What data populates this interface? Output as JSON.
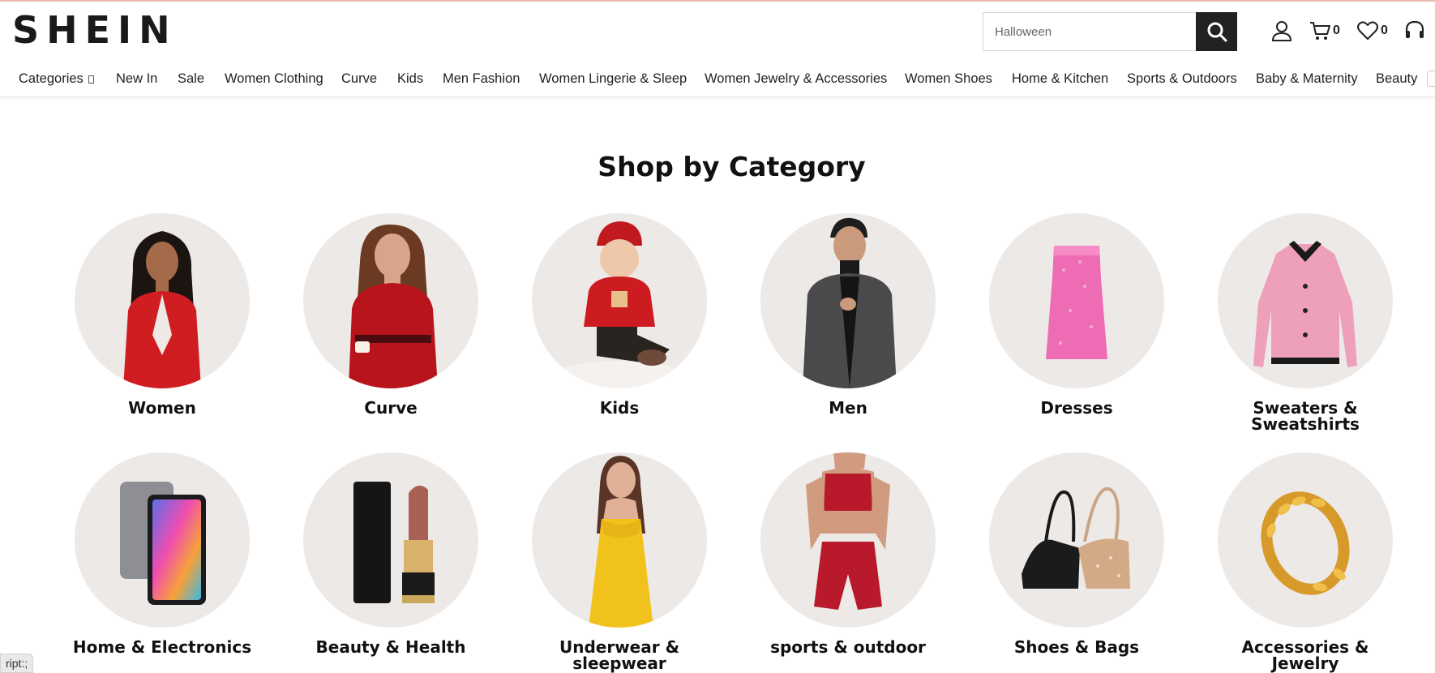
{
  "header": {
    "logo": "SHEIN",
    "search": {
      "placeholder": "Halloween"
    },
    "cart_count": "0",
    "wishlist_count": "0"
  },
  "nav": {
    "items": [
      "Categories ",
      "New In",
      "Sale",
      "Women Clothing",
      "Curve",
      "Kids",
      "Men Fashion",
      "Women Lingerie & Sleep",
      "Women Jewelry & Accessories",
      "Women Shoes",
      "Home & Kitchen",
      "Sports & Outdoors",
      "Baby & Maternity",
      "Beauty"
    ]
  },
  "main": {
    "title": "Shop by Category",
    "categories": [
      {
        "label": "Women",
        "icon": "red-blazer-woman-image"
      },
      {
        "label": "Curve",
        "icon": "red-sweater-woman-image"
      },
      {
        "label": "Kids",
        "icon": "toddler-red-sweater-image"
      },
      {
        "label": "Men",
        "icon": "grey-blazer-man-image"
      },
      {
        "label": "Dresses",
        "icon": "pink-sequin-dress-image"
      },
      {
        "label": "Sweaters & Sweatshirts",
        "icon": "pink-cardigan-image"
      },
      {
        "label": "Home & Electronics",
        "icon": "tablet-image"
      },
      {
        "label": "Beauty & Health",
        "icon": "lipstick-image"
      },
      {
        "label": "Underwear & sleepwear",
        "icon": "yellow-slip-dress-image"
      },
      {
        "label": "sports & outdoor",
        "icon": "red-sportswear-image"
      },
      {
        "label": "Shoes & Bags",
        "icon": "handbags-image"
      },
      {
        "label": "Accessories & Jewelry",
        "icon": "gold-ring-image"
      }
    ]
  },
  "status_bar": {
    "text": "ript:;"
  },
  "colors": {
    "accent_dark": "#222222",
    "circle_bg": "#ede9e7",
    "top_line": "#e9b8ae"
  }
}
